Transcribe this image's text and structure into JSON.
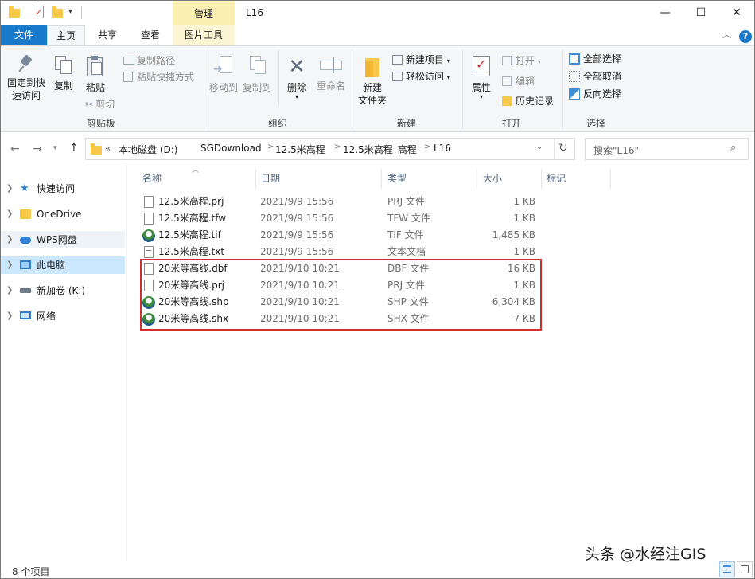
{
  "window": {
    "title": "L16",
    "context_tab_header": "管理"
  },
  "ribbon_tabs": {
    "file": "文件",
    "home": "主页",
    "share": "共享",
    "view": "查看",
    "picture_tools": "图片工具"
  },
  "ribbon": {
    "clipboard": {
      "label": "剪贴板",
      "pin": [
        "固定到快",
        "速访问"
      ],
      "copy": "复制",
      "paste": "粘贴",
      "copy_path": "复制路径",
      "paste_shortcut": "粘贴快捷方式",
      "cut": "剪切"
    },
    "organize": {
      "label": "组织",
      "move_to": "移动到",
      "copy_to": "复制到",
      "delete": "删除",
      "rename": "重命名"
    },
    "new": {
      "label": "新建",
      "new_folder": [
        "新建",
        "文件夹"
      ],
      "new_item": "新建项目",
      "easy_access": "轻松访问"
    },
    "open": {
      "label": "打开",
      "properties": "属性",
      "open": "打开",
      "edit": "编辑",
      "history": "历史记录"
    },
    "select": {
      "label": "选择",
      "select_all": "全部选择",
      "select_none": "全部取消",
      "invert": "反向选择"
    }
  },
  "address": {
    "overflow": "«",
    "crumbs": [
      "本地磁盘 (D:)",
      "SGDownload",
      "12.5米高程",
      "12.5米高程_高程",
      "L16"
    ],
    "search_placeholder": "搜索\"L16\""
  },
  "nav_pane": [
    {
      "label": "快速访问",
      "icon": "star-icon",
      "selected": false
    },
    {
      "label": "OneDrive",
      "icon": "folder-icon",
      "selected": false
    },
    {
      "label": "WPS网盘",
      "icon": "cloud-icon",
      "selected": false
    },
    {
      "label": "此电脑",
      "icon": "computer-icon",
      "selected": true
    },
    {
      "label": "新加卷 (K:)",
      "icon": "drive-icon",
      "selected": false
    },
    {
      "label": "网络",
      "icon": "network-icon",
      "selected": false
    }
  ],
  "columns": {
    "name": "名称",
    "date": "日期",
    "type": "类型",
    "size": "大小",
    "tags": "标记"
  },
  "files": [
    {
      "name": "12.5米高程.prj",
      "date": "2021/9/9 15:56",
      "type": "PRJ 文件",
      "size": "1 KB",
      "icon": "file-icon"
    },
    {
      "name": "12.5米高程.tfw",
      "date": "2021/9/9 15:56",
      "type": "TFW 文件",
      "size": "1 KB",
      "icon": "file-icon"
    },
    {
      "name": "12.5米高程.tif",
      "date": "2021/9/9 15:56",
      "type": "TIF 文件",
      "size": "1,485 KB",
      "icon": "gis-icon"
    },
    {
      "name": "12.5米高程.txt",
      "date": "2021/9/9 15:56",
      "type": "文本文档",
      "size": "1 KB",
      "icon": "text-file-icon"
    },
    {
      "name": "20米等高线.dbf",
      "date": "2021/9/10 10:21",
      "type": "DBF 文件",
      "size": "16 KB",
      "icon": "file-icon"
    },
    {
      "name": "20米等高线.prj",
      "date": "2021/9/10 10:21",
      "type": "PRJ 文件",
      "size": "1 KB",
      "icon": "file-icon"
    },
    {
      "name": "20米等高线.shp",
      "date": "2021/9/10 10:21",
      "type": "SHP 文件",
      "size": "6,304 KB",
      "icon": "gis-icon"
    },
    {
      "name": "20米等高线.shx",
      "date": "2021/9/10 10:21",
      "type": "SHX 文件",
      "size": "7 KB",
      "icon": "gis-icon"
    }
  ],
  "status": {
    "count": "8 个项目"
  },
  "watermark": "头条 @水经注GIS",
  "colors": {
    "accent": "#1979ca",
    "selected_nav": "#cce8ff",
    "highlight_box": "#d22c2c",
    "context_tab": "#fbefb2"
  }
}
